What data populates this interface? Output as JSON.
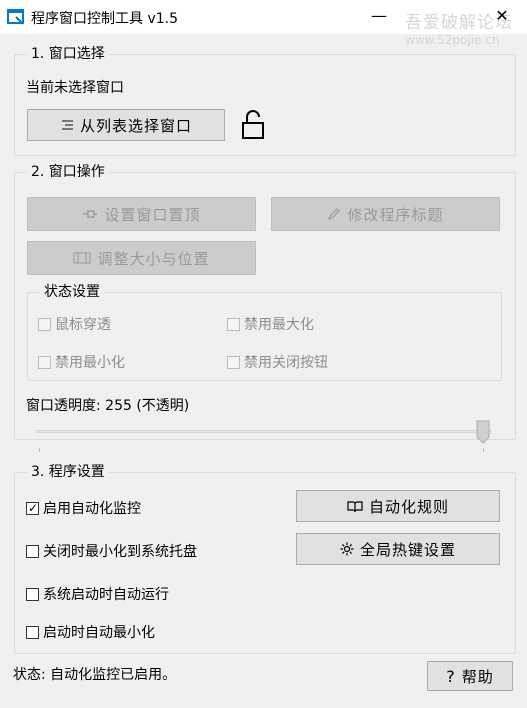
{
  "window": {
    "title": "程序窗口控制工具 v1.5",
    "minimize": "—",
    "maximize": "☐",
    "close": "✕"
  },
  "watermark": {
    "line1": "吾爱破解论坛",
    "line2": "www.52pojie.cn"
  },
  "section1": {
    "title": "1. 窗口选择",
    "current": "当前未选择窗口",
    "select_button": "从列表选择窗口",
    "lock_icon": "unlock-icon"
  },
  "section2": {
    "title": "2. 窗口操作",
    "topmost_button": "设置窗口置顶",
    "rename_button": "修改程序标题",
    "resize_button": "调整大小与位置",
    "state_group": {
      "title": "状态设置",
      "click_through": "鼠标穿透",
      "disable_maximize": "禁用最大化",
      "disable_minimize": "禁用最小化",
      "disable_close": "禁用关闭按钮"
    },
    "opacity_label": "窗口透明度: 255 (不透明)",
    "opacity_value": 255,
    "opacity_max": 255
  },
  "section3": {
    "title": "3. 程序设置",
    "auto_monitor": {
      "label": "启用自动化监控",
      "checked": true
    },
    "minimize_tray": {
      "label": "关闭时最小化到系统托盘",
      "checked": false
    },
    "autostart": {
      "label": "系统启动时自动运行",
      "checked": false
    },
    "start_minimized": {
      "label": "启动时自动最小化",
      "checked": false
    },
    "rules_button": "自动化规则",
    "hotkey_button": "全局热键设置"
  },
  "status": {
    "text": "状态: 自动化监控已启用。",
    "help_button": "帮助",
    "help_glyph": "?"
  },
  "colors": {
    "accent": "#0078d7",
    "disabled_bg": "#cccccc",
    "border": "#dcdcdc"
  }
}
